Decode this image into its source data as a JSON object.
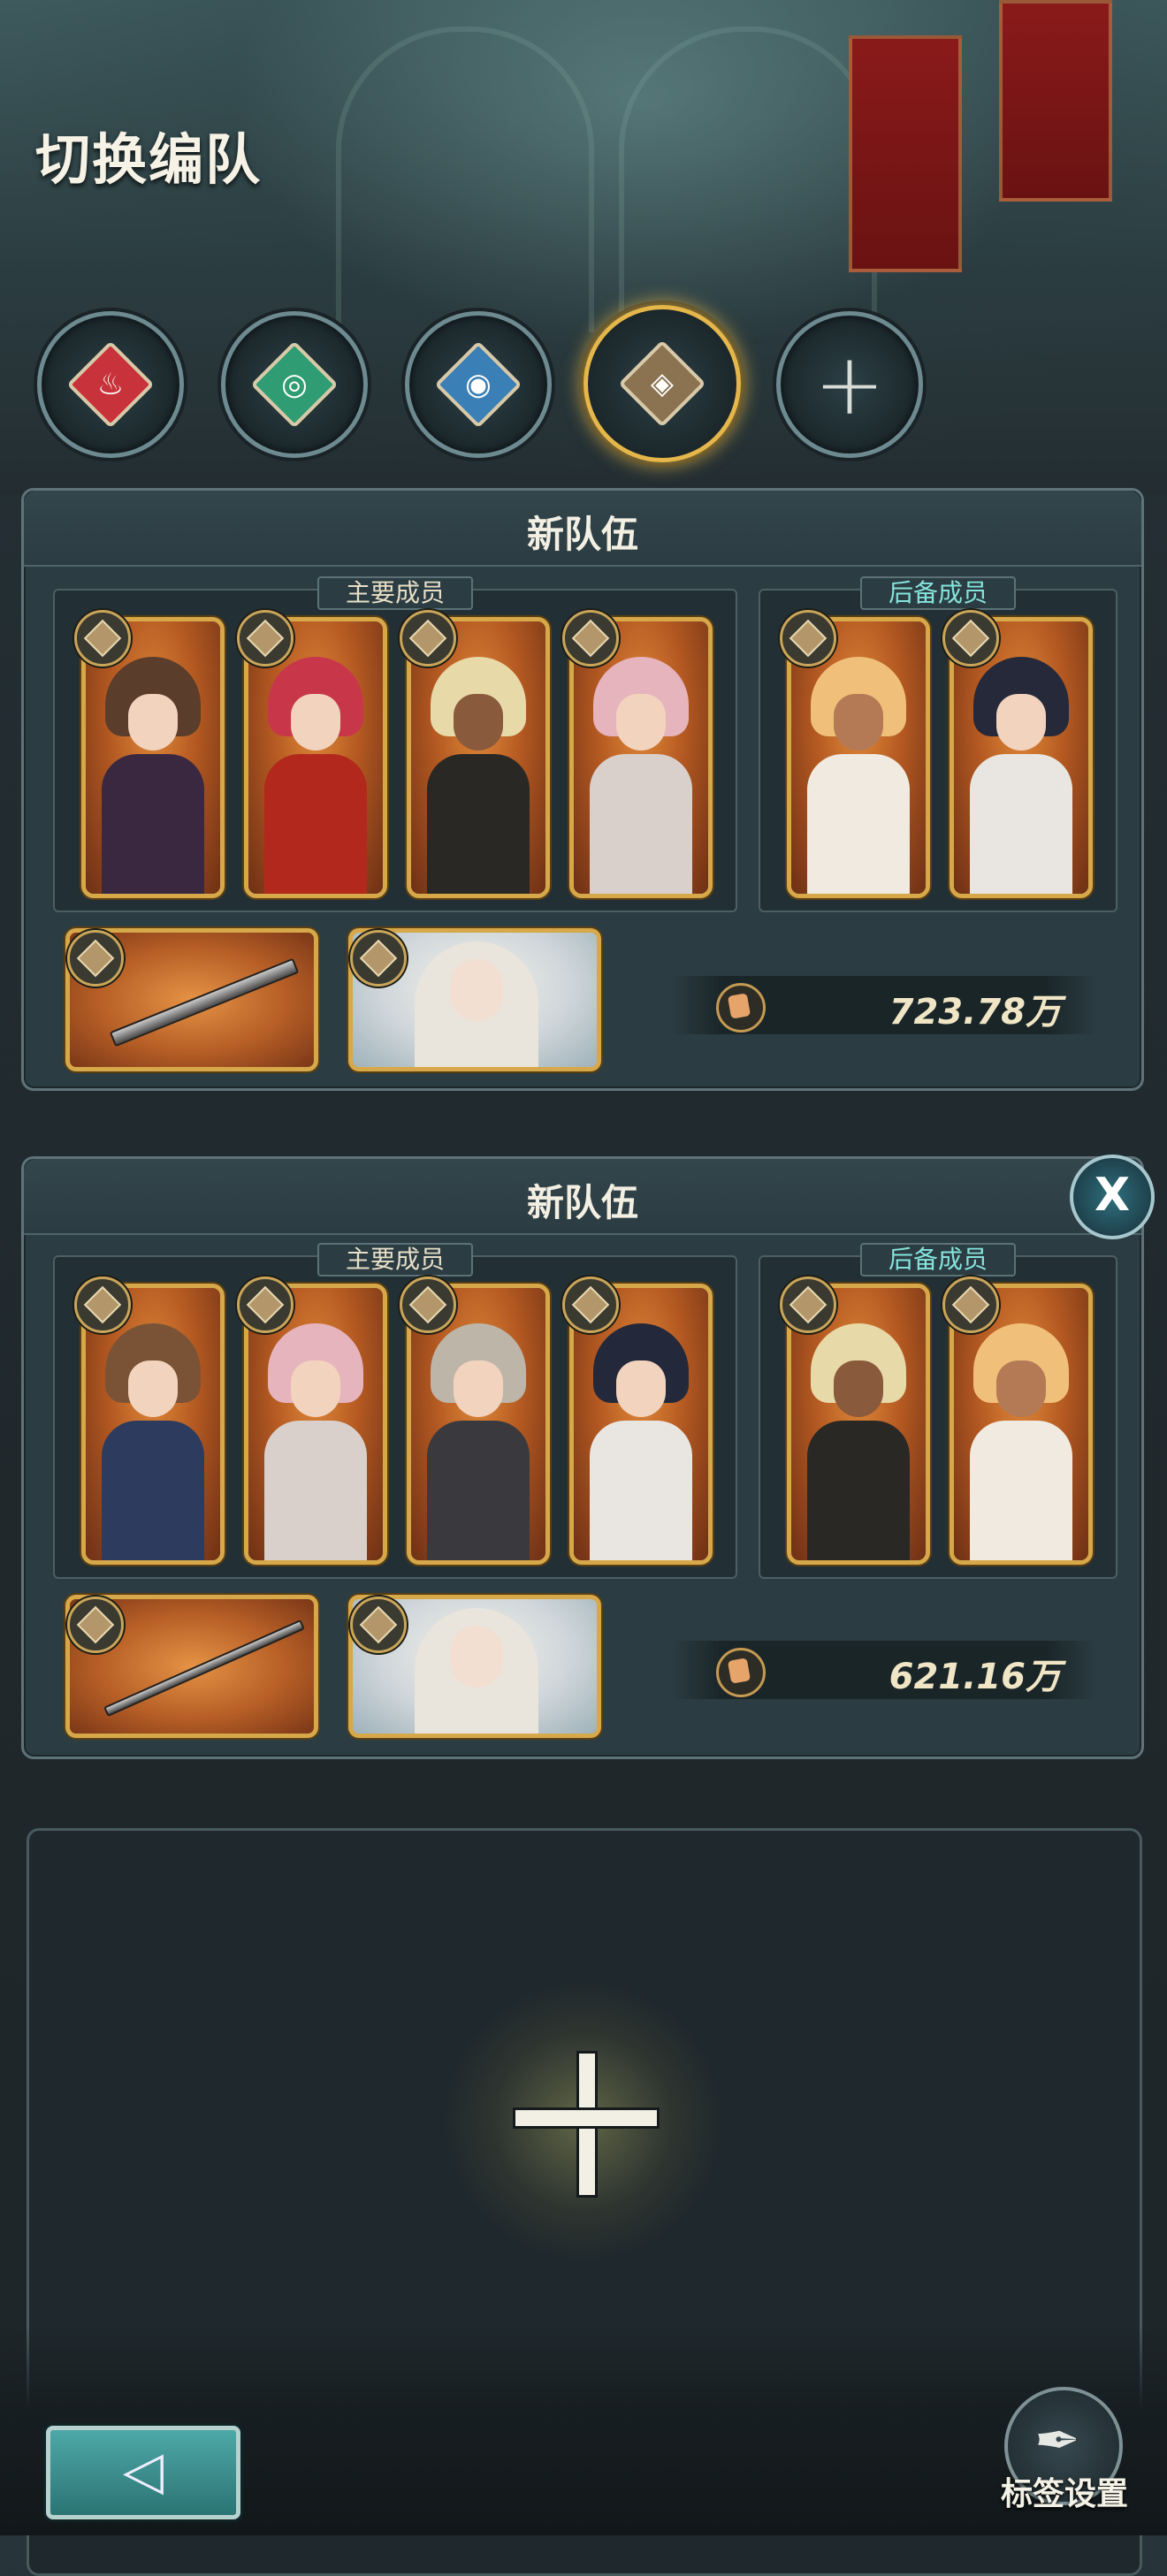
{
  "header": {
    "title": "切换编队"
  },
  "element_tabs": [
    {
      "name": "fire",
      "color": "#c8323a",
      "glyph": "♨",
      "active": false
    },
    {
      "name": "wind",
      "color": "#2f9c73",
      "glyph": "◎",
      "active": false
    },
    {
      "name": "water",
      "color": "#3a7fb5",
      "glyph": "◉",
      "active": false
    },
    {
      "name": "earth",
      "color": "#8b7250",
      "glyph": "◈",
      "active": true
    },
    {
      "name": "add",
      "glyph": "+"
    }
  ],
  "teams": [
    {
      "title": "新队伍",
      "main_label": "主要成员",
      "reserve_label": "后备成员",
      "power": "723.78万",
      "main_members": [
        {
          "hair": "#5b3d2b",
          "outfit": "#3a2840"
        },
        {
          "hair": "#c8364a",
          "outfit": "#b2281c"
        },
        {
          "hair": "#e8d9a8",
          "outfit": "#2a2824"
        },
        {
          "hair": "#e6b4bc",
          "outfit": "#d9d0cc"
        }
      ],
      "reserve_members": [
        {
          "hair": "#f0c07a",
          "outfit": "#f0eae0"
        },
        {
          "hair": "#25293a",
          "outfit": "#e9e6e2"
        }
      ],
      "weapon": "sword"
    },
    {
      "title": "新队伍",
      "main_label": "主要成员",
      "reserve_label": "后备成员",
      "power": "621.16万",
      "main_members": [
        {
          "hair": "#7a5336",
          "outfit": "#2d3c5e"
        },
        {
          "hair": "#e6b4bc",
          "outfit": "#d9d0cc"
        },
        {
          "hair": "#bdb6a8",
          "outfit": "#3a3a3e"
        },
        {
          "hair": "#23293a",
          "outfit": "#e9e6e2"
        }
      ],
      "reserve_members": [
        {
          "hair": "#e8d9a8",
          "outfit": "#2a2824"
        },
        {
          "hair": "#f0c07a",
          "outfit": "#f0eae0"
        }
      ],
      "weapon": "spear"
    }
  ],
  "close_label": "X",
  "footer": {
    "back_glyph": "◁",
    "tag_settings_label": "标签设置"
  }
}
